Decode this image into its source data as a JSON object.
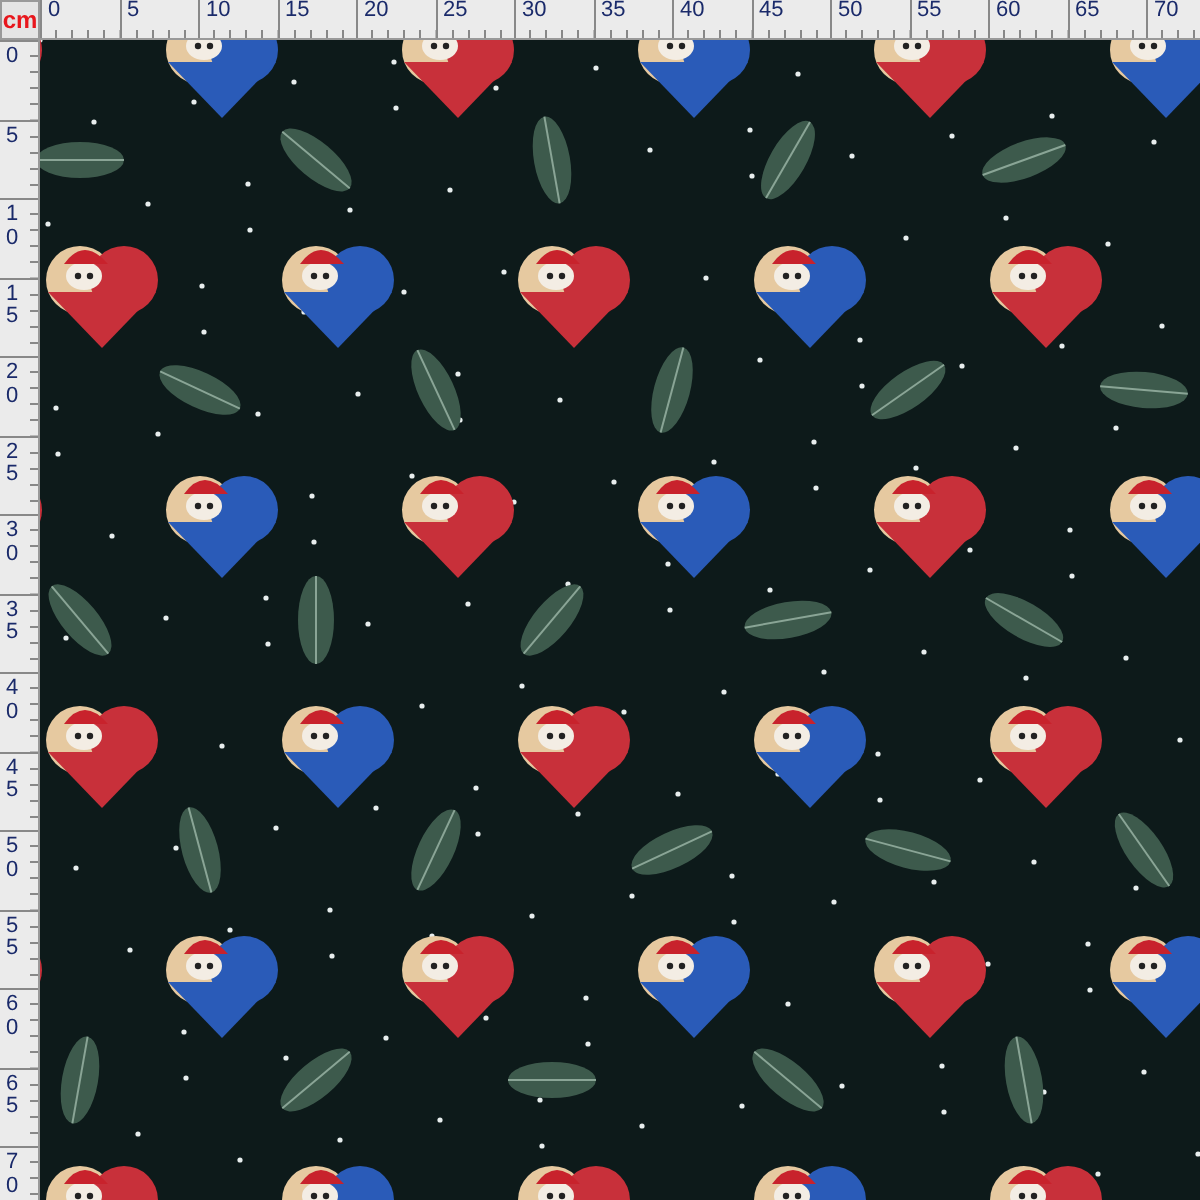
{
  "rulers": {
    "unit": "cm",
    "horizontal_labels": [
      "0",
      "5",
      "10",
      "15",
      "20",
      "25",
      "30",
      "35",
      "40",
      "45",
      "50",
      "55",
      "60",
      "65",
      "70"
    ],
    "vertical_labels": [
      "0",
      "5",
      "10",
      "15",
      "20",
      "25",
      "30",
      "35",
      "40",
      "45",
      "50",
      "55",
      "60",
      "65",
      "70"
    ]
  }
}
